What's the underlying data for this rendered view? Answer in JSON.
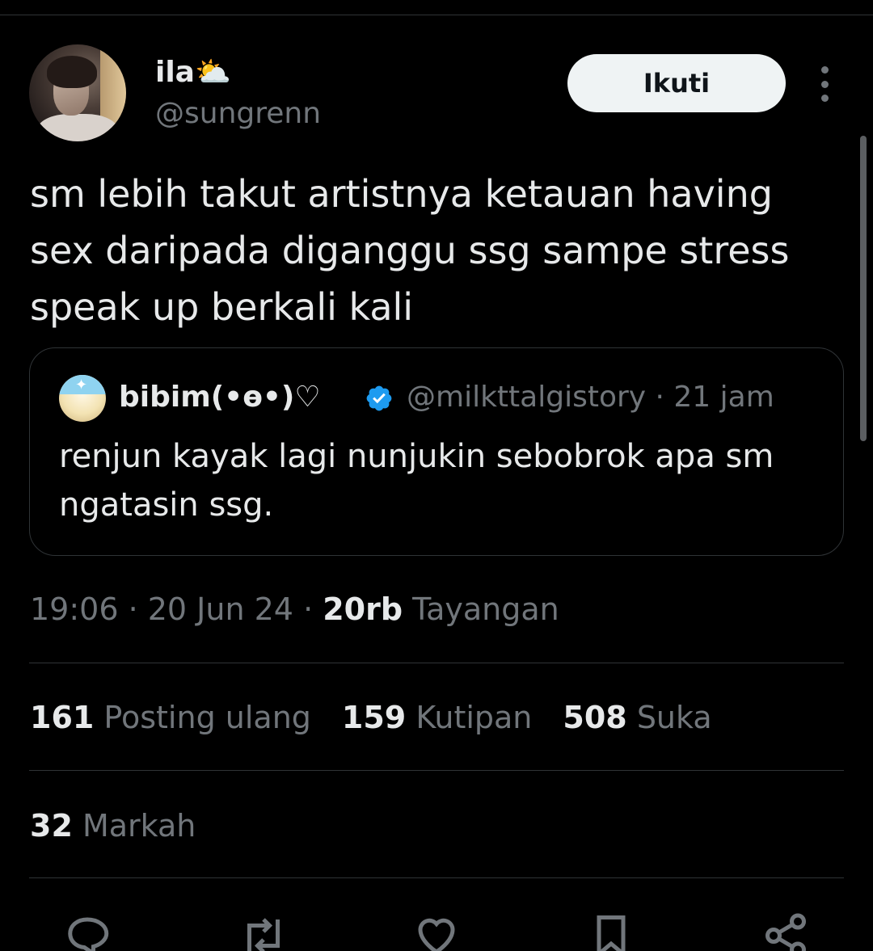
{
  "author": {
    "display_name": "ila⛅",
    "handle": "@sungrenn"
  },
  "follow_button": {
    "label": "Ikuti"
  },
  "tweet": {
    "text": "sm lebih takut artistnya ketauan having sex daripada diganggu ssg sampe stress speak up berkali kali"
  },
  "quoted_tweet": {
    "display_name": "bibim(•ɵ•)♡",
    "handle_time": "@milkttalgistory · 21 jam",
    "text": "renjun kayak lagi nunjukin sebobrok apa sm ngatasin ssg."
  },
  "meta": {
    "datetime": "19:06 · 20 Jun 24 · ",
    "views_count": "20rb",
    "views_label": " Tayangan"
  },
  "stats": {
    "reposts_count": "161",
    "reposts_label": "Posting ulang",
    "quotes_count": "159",
    "quotes_label": "Kutipan",
    "likes_count": "508",
    "likes_label": "Suka",
    "bookmarks_count": "32",
    "bookmarks_label": "Markah"
  },
  "actions": [
    "reply-icon",
    "repost-icon",
    "like-icon",
    "bookmark-icon",
    "share-icon"
  ],
  "colors": {
    "background": "#000000",
    "text_primary": "#e7e9ea",
    "text_secondary": "#71767b",
    "border": "#2f3336",
    "verified": "#1d9bf0"
  }
}
